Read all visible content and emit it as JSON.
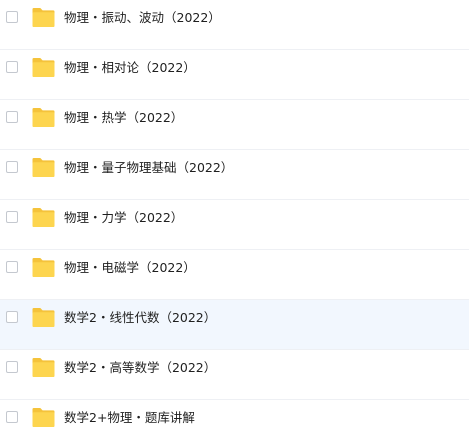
{
  "colors": {
    "folder_back": "#f5c33b",
    "folder_front": "#fdd54f",
    "row_highlight": "#f2f7fe",
    "divider": "#eef0f4",
    "text": "#1f1f1f"
  },
  "file_list": {
    "items": [
      {
        "name": "物理・振动、波动（2022）",
        "type": "folder",
        "icon": "folder-icon",
        "checked": false
      },
      {
        "name": "物理・相对论（2022）",
        "type": "folder",
        "icon": "folder-icon",
        "checked": false
      },
      {
        "name": "物理・热学（2022）",
        "type": "folder",
        "icon": "folder-icon",
        "checked": false
      },
      {
        "name": "物理・量子物理基础（2022）",
        "type": "folder",
        "icon": "folder-icon",
        "checked": false
      },
      {
        "name": "物理・力学（2022）",
        "type": "folder",
        "icon": "folder-icon",
        "checked": false
      },
      {
        "name": "物理・电磁学（2022）",
        "type": "folder",
        "icon": "folder-icon",
        "checked": false
      },
      {
        "name": "数学2・线性代数（2022）",
        "type": "folder",
        "icon": "folder-icon",
        "checked": false,
        "hovered": true
      },
      {
        "name": "数学2・高等数学（2022）",
        "type": "folder",
        "icon": "folder-icon",
        "checked": false
      },
      {
        "name": "数学2+物理・题库讲解",
        "type": "folder",
        "icon": "folder-icon",
        "checked": false
      }
    ]
  }
}
